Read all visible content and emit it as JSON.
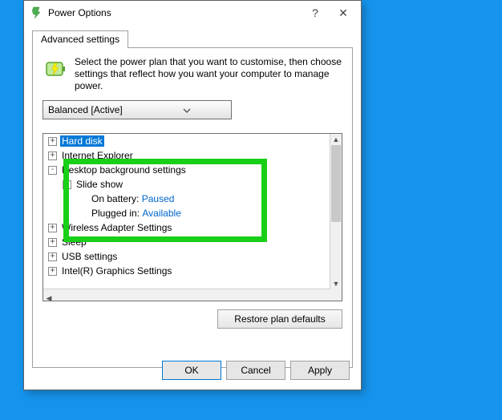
{
  "window": {
    "title": "Power Options",
    "help": "?",
    "close": "✕"
  },
  "tab": {
    "label": "Advanced settings"
  },
  "intro": "Select the power plan that you want to customise, then choose settings that reflect how you want your computer to manage power.",
  "plan": {
    "selected": "Balanced [Active]"
  },
  "tree": {
    "hard_disk": "Hard disk",
    "ie": "Internet Explorer",
    "desktop_bg": "Desktop background settings",
    "slide_show": "Slide show",
    "on_battery_label": "On battery:",
    "on_battery_value": "Paused",
    "plugged_in_label": "Plugged in:",
    "plugged_in_value": "Available",
    "wireless": "Wireless Adapter Settings",
    "sleep": "Sleep",
    "usb": "USB settings",
    "intel": "Intel(R) Graphics Settings"
  },
  "restore": "Restore plan defaults",
  "buttons": {
    "ok": "OK",
    "cancel": "Cancel",
    "apply": "Apply"
  }
}
